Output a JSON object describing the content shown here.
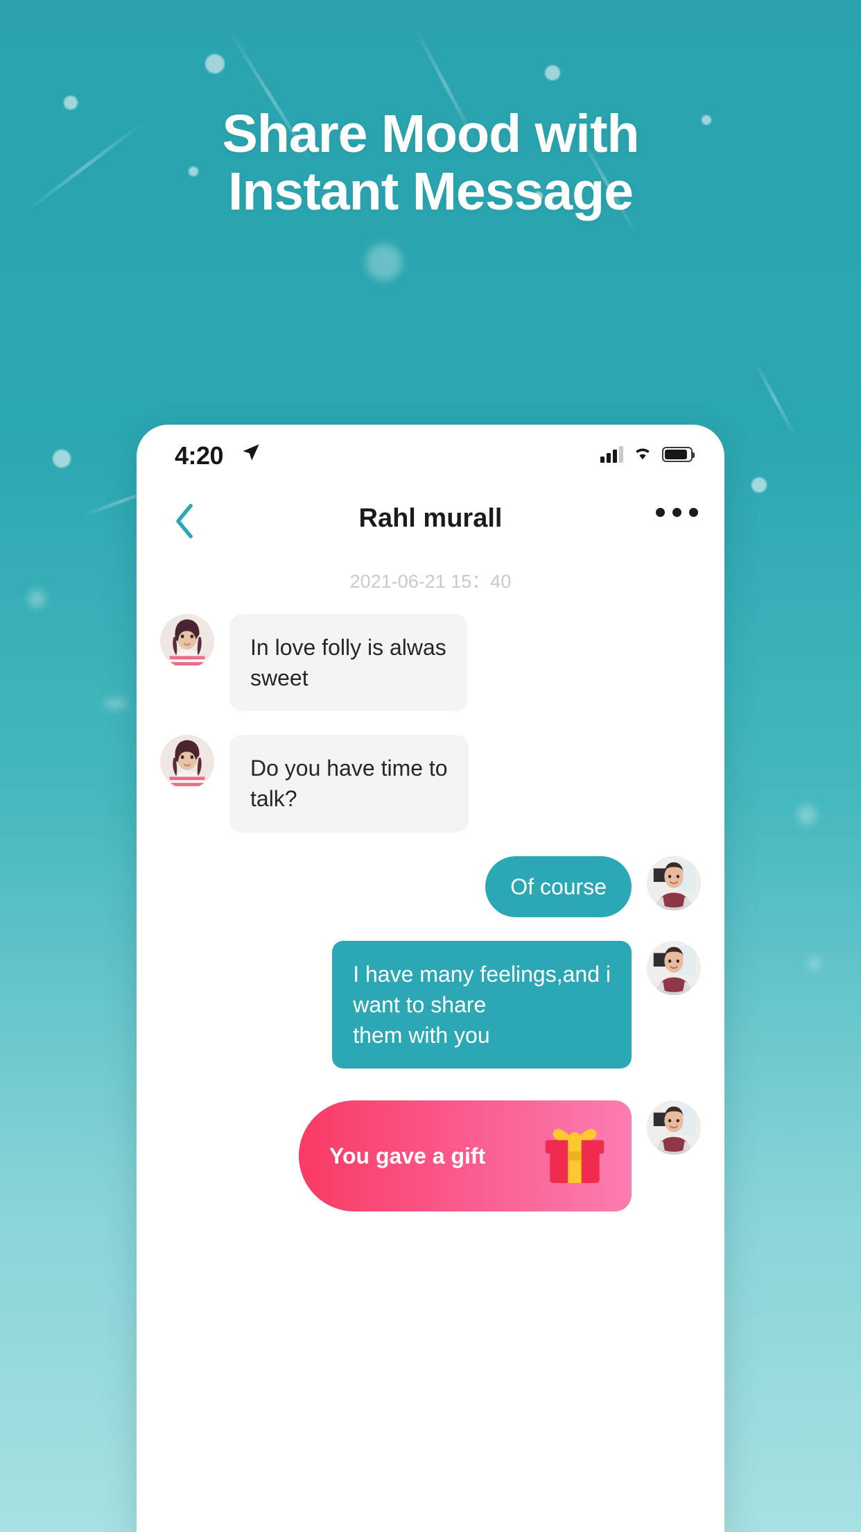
{
  "promo": {
    "headline_line1": "Share Mood with",
    "headline_line2": "Instant Message",
    "background_color": "#2ba7b1",
    "background_color_bottom": "#a8e0e2"
  },
  "phone": {
    "status_bar": {
      "time": "4:20",
      "location_icon": "location-arrow-icon",
      "signal_icon": "cellular-signal-icon",
      "wifi_icon": "wifi-icon",
      "battery_icon": "battery-icon"
    },
    "nav_bar": {
      "back_icon": "chevron-left-icon",
      "title": "Rahl murall",
      "more_icon": "more-horizontal-icon",
      "accent_color": "#2ba8b4"
    },
    "chat": {
      "daystamp": "2021-06-21 15：40",
      "messages": [
        {
          "side": "in",
          "avatar": "contact-avatar",
          "text": "In love folly is alwas\nsweet",
          "type": "text"
        },
        {
          "side": "in",
          "avatar": "contact-avatar",
          "text": "Do you have time to\ntalk?",
          "type": "text"
        },
        {
          "side": "out",
          "avatar": "user-avatar",
          "text": "Of course",
          "type": "text"
        },
        {
          "side": "out",
          "avatar": "user-avatar",
          "text": "I have many feelings,and i\nwant to share\nthem with you",
          "type": "text"
        },
        {
          "side": "out",
          "avatar": "user-avatar",
          "text": "You gave a gift",
          "type": "gift",
          "icon": "gift-box-icon"
        }
      ],
      "bubble_in_color": "#f4f4f6",
      "bubble_out_color": "#2ba8b4",
      "gift_gradient_start": "#f93a64",
      "gift_gradient_end": "#fb7db2"
    }
  }
}
